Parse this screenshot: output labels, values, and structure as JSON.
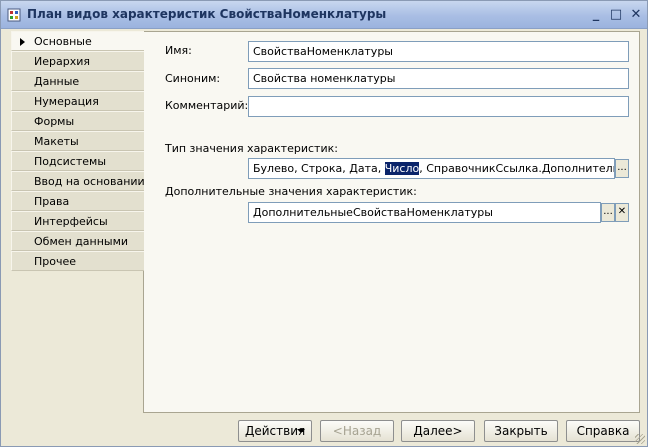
{
  "window": {
    "title": "План видов характеристик СвойстваНоменклатуры",
    "controls": {
      "minimize": "_",
      "maximize": "□",
      "close": "✕"
    },
    "icon": "config-object-icon"
  },
  "sidebar": {
    "items": [
      {
        "label": "Основные",
        "active": true
      },
      {
        "label": "Иерархия"
      },
      {
        "label": "Данные"
      },
      {
        "label": "Нумерация"
      },
      {
        "label": "Формы"
      },
      {
        "label": "Макеты"
      },
      {
        "label": "Подсистемы"
      },
      {
        "label": "Ввод на основании"
      },
      {
        "label": "Права"
      },
      {
        "label": "Интерфейсы"
      },
      {
        "label": "Обмен данными"
      },
      {
        "label": "Прочее"
      }
    ]
  },
  "form": {
    "name_label": "Имя:",
    "name_value": "СвойстваНоменклатуры",
    "synonym_label": "Синоним:",
    "synonym_value": "Свойства номенклатуры",
    "comment_label": "Комментарий:",
    "comment_value": "",
    "type_label": "Тип значения характеристик:",
    "type_before": "Булево, Строка, Дата, ",
    "type_selected": "Число",
    "type_after": ", СправочникСсылка.ДополнительныеСво",
    "type_button": "...",
    "extra_label": "Дополнительные значения характеристик:",
    "extra_value": "ДополнительныеСвойстваНоменклатуры",
    "extra_select_button": "...",
    "extra_clear_button": "✕"
  },
  "buttons": {
    "actions": "Действия",
    "back": "<Назад",
    "next": "Далее>",
    "close": "Закрыть",
    "help": "Справка"
  },
  "colors": {
    "selection": "#0a246a",
    "titlebar": "#a9bee4",
    "field_border": "#7f9db9"
  }
}
